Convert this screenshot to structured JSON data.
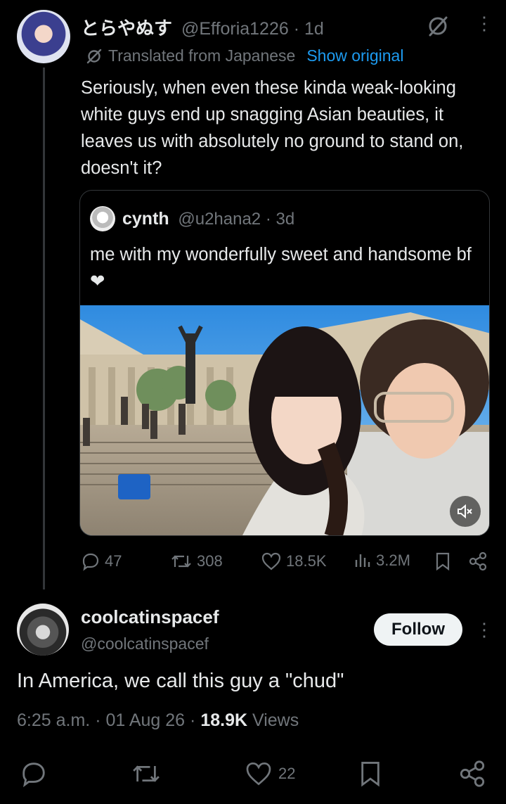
{
  "post": {
    "author_name": "とらやぬす",
    "author_handle": "@Efforia1226",
    "time": "1d",
    "translated_label": "Translated from Japanese",
    "show_original_label": "Show original",
    "text": "Seriously, when even these kinda weak-looking white guys end up snagging Asian beauties, it leaves us with absolutely no ground to stand on, doesn't it?",
    "quote": {
      "author_name": "cynth",
      "author_handle": "@u2hana2",
      "time": "3d",
      "text": "me with my wonderfully sweet and handsome bf ❤"
    },
    "stats": {
      "replies": "47",
      "reposts": "308",
      "likes": "18.5K",
      "views": "3.2M"
    }
  },
  "reply": {
    "author_name": "coolcatinspacef",
    "author_handle": "@coolcatinspacef",
    "follow_label": "Follow",
    "text": "In America, we call this guy a \"chud\"",
    "time": "6:25 a.m.",
    "date": "01 Aug 26",
    "views_count": "18.9K",
    "views_label": "Views",
    "likes": "22"
  },
  "colors": {
    "background": "#000000",
    "text": "#e7e9ea",
    "muted": "#71767b",
    "link": "#1d9bf0",
    "border": "#333639"
  }
}
